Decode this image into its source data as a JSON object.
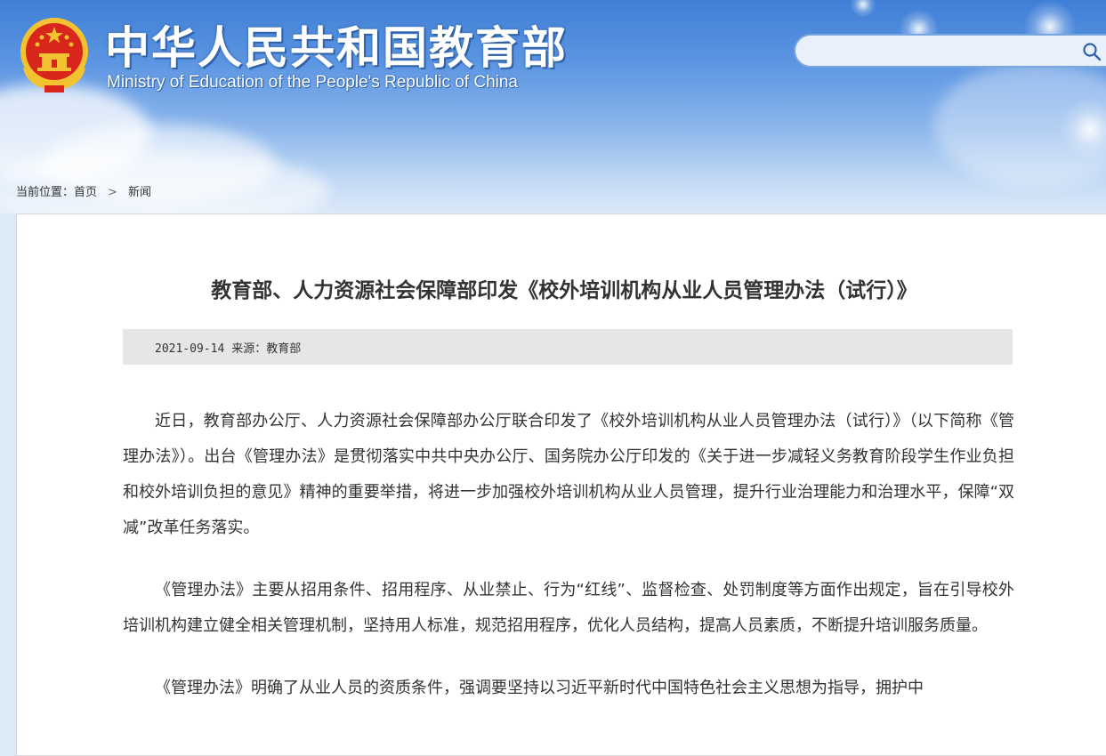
{
  "header": {
    "site_title": "中华人民共和国教育部",
    "site_subtitle": "Ministry of Education of the People's Republic of China",
    "search_placeholder": ""
  },
  "breadcrumb": {
    "prefix": "当前位置：",
    "items": [
      "首页",
      "新闻"
    ],
    "separator": ">"
  },
  "article": {
    "title": "教育部、人力资源社会保障部印发《校外培训机构从业人员管理办法（试行）》",
    "date": "2021-09-14",
    "source": "来源：教育部",
    "paragraphs": [
      "近日，教育部办公厅、人力资源社会保障部办公厅联合印发了《校外培训机构从业人员管理办法（试行）》（以下简称《管理办法》）。出台《管理办法》是贯彻落实中共中央办公厅、国务院办公厅印发的《关于进一步减轻义务教育阶段学生作业负担和校外培训负担的意见》精神的重要举措，将进一步加强校外培训机构从业人员管理，提升行业治理能力和治理水平，保障“双减”改革任务落实。",
      "《管理办法》主要从招用条件、招用程序、从业禁止、行为“红线”、监督检查、处罚制度等方面作出规定，旨在引导校外培训机构建立健全相关管理机制，坚持用人标准，规范招用程序，优化人员结构，提高人员素质，不断提升培训服务质量。",
      "《管理办法》明确了从业人员的资质条件，强调要坚持以习近平新时代中国特色社会主义思想为指导，拥护中"
    ]
  },
  "icons": {
    "emblem": "national-emblem-icon",
    "search": "search-icon"
  },
  "colors": {
    "header_top": "#3f7fd6",
    "title_text": "#333333",
    "meta_bar": "#e6e6e6",
    "emblem_red": "#d8261c",
    "emblem_gold": "#f2c230"
  }
}
